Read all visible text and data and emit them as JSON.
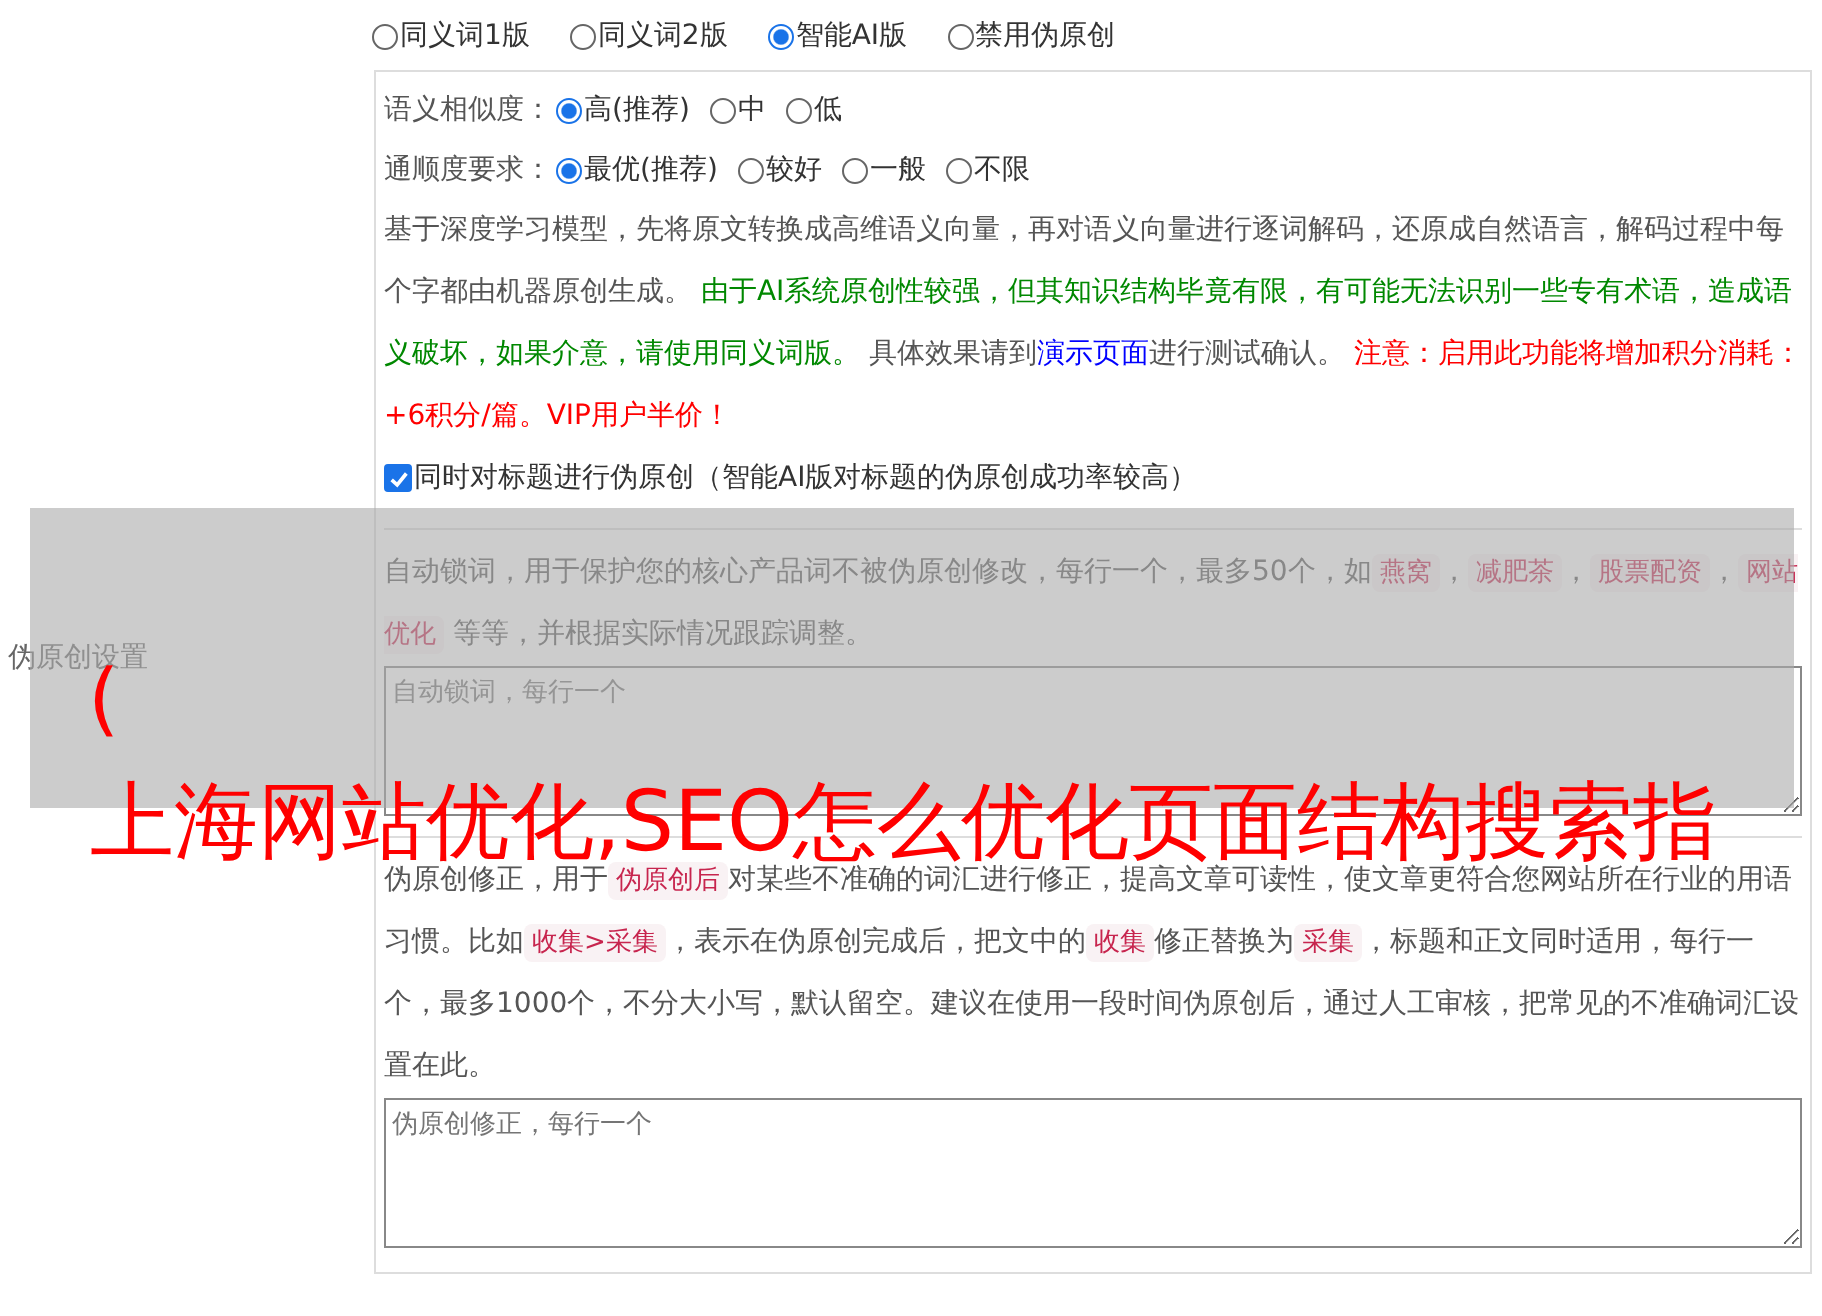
{
  "section_label": "伪原创设置",
  "modes": [
    {
      "label": "同义词1版",
      "selected": false
    },
    {
      "label": "同义词2版",
      "selected": false
    },
    {
      "label": "智能AI版",
      "selected": true
    },
    {
      "label": "禁用伪原创",
      "selected": false
    }
  ],
  "option_groups": [
    {
      "label": "语义相似度：",
      "options": [
        {
          "label": "高(推荐)",
          "selected": true
        },
        {
          "label": "中",
          "selected": false
        },
        {
          "label": "低",
          "selected": false
        }
      ]
    },
    {
      "label": "通顺度要求：",
      "options": [
        {
          "label": "最优(推荐)",
          "selected": true
        },
        {
          "label": "较好",
          "selected": false
        },
        {
          "label": "一般",
          "selected": false
        },
        {
          "label": "不限",
          "selected": false
        }
      ]
    }
  ],
  "ai_description": [
    {
      "kind": "plain",
      "text": "基于深度学习模型，先将原文转换成高维语义向量，再对语义向量进行逐词解码，还原成自然语言，解码过程中每个字都由机器原创生成。 "
    },
    {
      "kind": "green",
      "text": "由于AI系统原创性较强，但其知识结构毕竟有限，有可能无法识别一些专有术语，造成语义破坏，如果介意，请使用同义词版。"
    },
    {
      "kind": "plain",
      "text": " 具体效果请到"
    },
    {
      "kind": "link",
      "text": "演示页面"
    },
    {
      "kind": "plain",
      "text": "进行测试确认。 "
    },
    {
      "kind": "red",
      "text": "注意：启用此功能将增加积分消耗：+6积分/篇。VIP用户半价！"
    }
  ],
  "title_option": {
    "label": "同时对标题进行伪原创（智能AI版对标题的伪原创成功率较高）",
    "checked": true
  },
  "sections": [
    {
      "description": [
        {
          "kind": "plain",
          "text": "自动锁词，用于保护您的核心产品词不被伪原创修改，每行一个，最多50个，如"
        },
        {
          "kind": "code",
          "text": "燕窝"
        },
        {
          "kind": "plain",
          "text": "，"
        },
        {
          "kind": "code",
          "text": "减肥茶"
        },
        {
          "kind": "plain",
          "text": "，"
        },
        {
          "kind": "code",
          "text": "股票配资"
        },
        {
          "kind": "plain",
          "text": "，"
        },
        {
          "kind": "code",
          "text": "网站优化"
        },
        {
          "kind": "plain",
          "text": " 等等，并根据实际情况跟踪调整。"
        }
      ],
      "placeholder": "自动锁词，每行一个"
    },
    {
      "description": [
        {
          "kind": "plain",
          "text": "伪原创修正，用于"
        },
        {
          "kind": "code",
          "text": "伪原创后"
        },
        {
          "kind": "plain",
          "text": "对某些不准确的词汇进行修正，提高文章可读性，使文章更符合您网站所在行业的用语习惯。比如"
        },
        {
          "kind": "code",
          "text": "收集>采集"
        },
        {
          "kind": "plain",
          "text": "，表示在伪原创完成后，把文中的"
        },
        {
          "kind": "code",
          "text": "收集"
        },
        {
          "kind": "plain",
          "text": "修正替换为"
        },
        {
          "kind": "code",
          "text": "采集"
        },
        {
          "kind": "plain",
          "text": "，标题和正文同时适用，每行一个，最多1000个，不分大小写，默认留空。建议在使用一段时间伪原创后，通过人工审核，把常见的不准确词汇设置在此。"
        }
      ],
      "placeholder": "伪原创修正，每行一个"
    }
  ],
  "overlay": {
    "bracket": "(",
    "headline": "上海网站优化,SEO怎么优化页面结构搜索指"
  }
}
